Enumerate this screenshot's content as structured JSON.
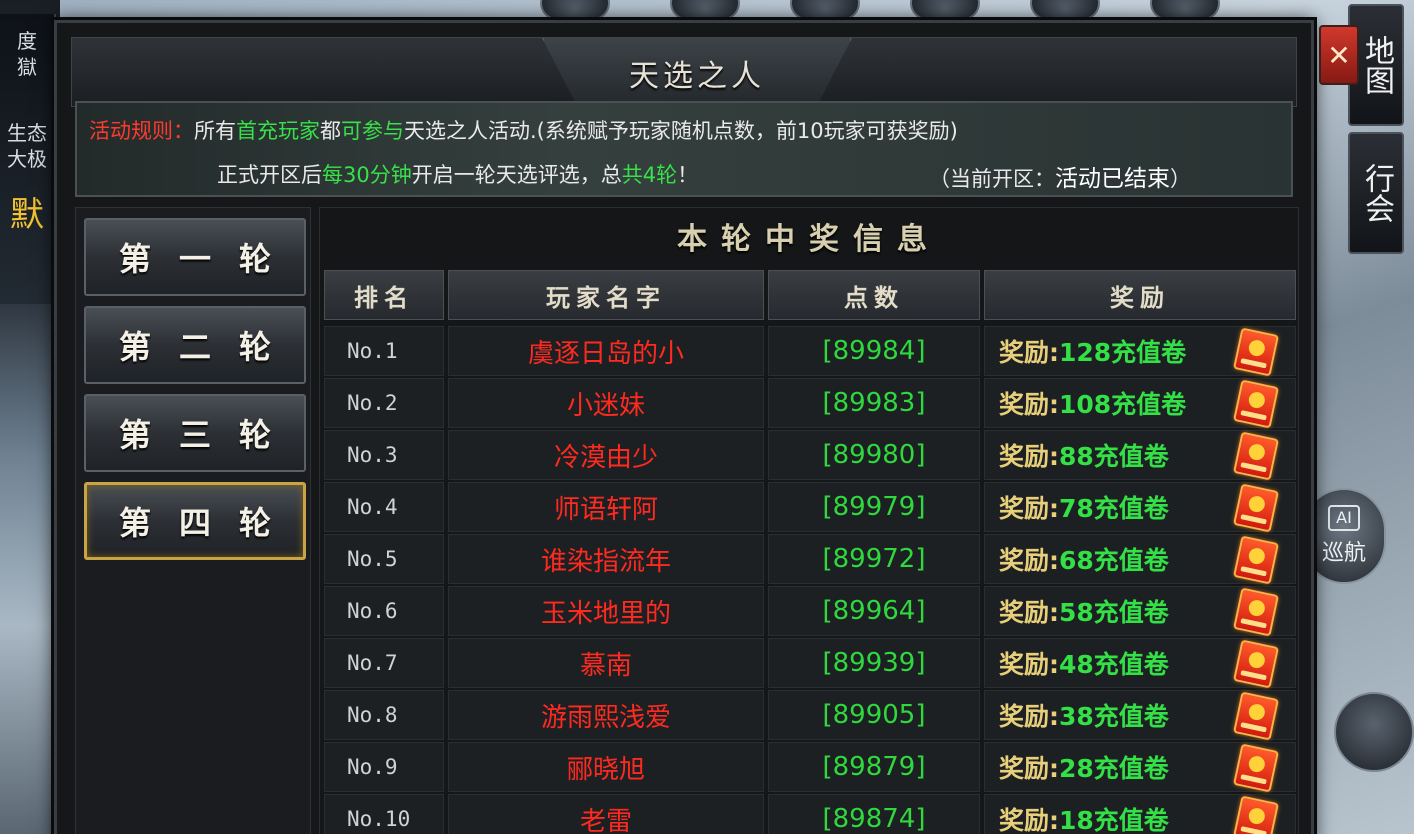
{
  "colors": {
    "name_red": "#ff2a1f",
    "points_green": "#2fd83c",
    "reward_gold": "#e8cf7a",
    "active_tab_border": "#c9a444",
    "rule_red": "#ff3a2c",
    "rule_green": "#38e04a"
  },
  "background": {
    "left_badge_lines": [
      "度",
      "獄",
      "生态",
      "大极"
    ],
    "left_badge_glyph": "默"
  },
  "side_tabs": {
    "map_label": "地图",
    "guild_label": "行会",
    "ai_box": "AI",
    "ai_label": "巡航"
  },
  "panel": {
    "title": "天选之人",
    "close_icon": "✕"
  },
  "rules": {
    "line1": [
      {
        "text": "活动规则：",
        "color": "red"
      },
      {
        "text": "所有",
        "color": "white"
      },
      {
        "text": "首充玩家",
        "color": "green"
      },
      {
        "text": "都",
        "color": "white"
      },
      {
        "text": "可参与",
        "color": "green"
      },
      {
        "text": "天选之人活动.(系统赋予玩家随机点数，前10玩家可获奖励)",
        "color": "white"
      }
    ],
    "line2": [
      {
        "text": "正式开区后",
        "color": "white"
      },
      {
        "text": "每30分钟",
        "color": "green"
      },
      {
        "text": "开启一轮天选评选，总",
        "color": "white"
      },
      {
        "text": "共4轮",
        "color": "green"
      },
      {
        "text": "！",
        "color": "white"
      }
    ],
    "status_prefix": "（当前开区：",
    "status_value": "活动已结束",
    "status_suffix": "）"
  },
  "rounds": {
    "tabs": [
      "第一轮",
      "第二轮",
      "第三轮",
      "第四轮"
    ],
    "active_index": 3
  },
  "info": {
    "title": "本轮中奖信息",
    "headers": {
      "rank": "排名",
      "name": "玩家名字",
      "points": "点数",
      "reward": "奖励"
    },
    "rows": [
      {
        "rank": "No.1",
        "name": "虞逐日岛的小",
        "points": "[89984]",
        "reward_label": "奖励:",
        "reward_value": "128充值卷",
        "icon": "red-envelope-icon"
      },
      {
        "rank": "No.2",
        "name": "小迷妹",
        "points": "[89983]",
        "reward_label": "奖励:",
        "reward_value": "108充值卷",
        "icon": "red-envelope-icon"
      },
      {
        "rank": "No.3",
        "name": "冷漠由少",
        "points": "[89980]",
        "reward_label": "奖励: ",
        "reward_value": "88充值卷",
        "icon": "red-envelope-icon"
      },
      {
        "rank": "No.4",
        "name": "师语轩阿",
        "points": "[89979]",
        "reward_label": "奖励: ",
        "reward_value": "78充值卷",
        "icon": "red-envelope-icon"
      },
      {
        "rank": "No.5",
        "name": "谁染指流年",
        "points": "[89972]",
        "reward_label": "奖励: ",
        "reward_value": "68充值卷",
        "icon": "red-envelope-icon"
      },
      {
        "rank": "No.6",
        "name": "玉米地里的",
        "points": "[89964]",
        "reward_label": "奖励: ",
        "reward_value": "58充值卷",
        "icon": "red-envelope-icon"
      },
      {
        "rank": "No.7",
        "name": "慕南",
        "points": "[89939]",
        "reward_label": "奖励: ",
        "reward_value": "48充值卷",
        "icon": "red-envelope-icon"
      },
      {
        "rank": "No.8",
        "name": "游雨熙浅爱",
        "points": "[89905]",
        "reward_label": "奖励: ",
        "reward_value": "38充值卷",
        "icon": "red-envelope-icon"
      },
      {
        "rank": "No.9",
        "name": "郦晓旭",
        "points": "[89879]",
        "reward_label": "奖励: ",
        "reward_value": "28充值卷",
        "icon": "red-envelope-icon"
      },
      {
        "rank": "No.10",
        "name": "老雷",
        "points": "[89874]",
        "reward_label": "奖励: ",
        "reward_value": "18充值卷",
        "icon": "red-envelope-icon"
      }
    ]
  }
}
